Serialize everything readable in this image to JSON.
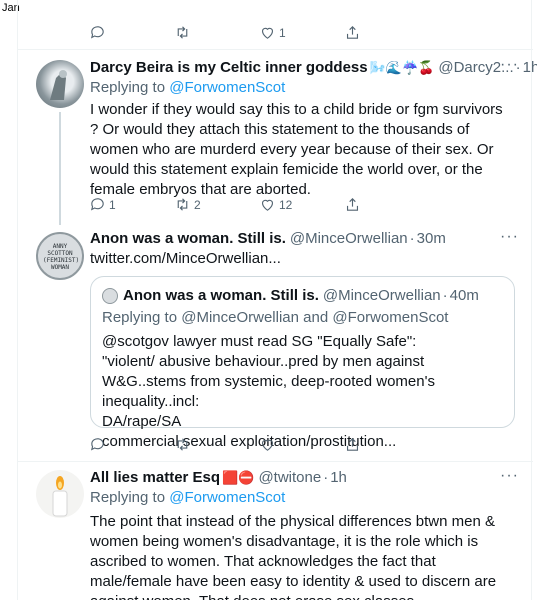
{
  "corner_label": "Jan",
  "top_actions": {
    "reply": "",
    "retweet": "",
    "like": "1",
    "share": ""
  },
  "tweet1": {
    "name": "Darcy Beira is my Celtic inner goddess",
    "name_emojis": "🌬️🌊☔️🍒",
    "handle": "@Darcy2...",
    "dot": "·",
    "time": "1h",
    "replying_prefix": "Replying to",
    "replying_to": "@ForwomenScot",
    "text": "I wonder if they would say this to a child bride or fgm survivors ? Or would they attach this statement to the thousands of women who are murderd every year because of their sex. Or would this statement explain femicide the world over, or the female embryos that are aborted.",
    "reply_count": "1",
    "retweet_count": "2",
    "like_count": "12"
  },
  "tweet2": {
    "name": "Anon was a woman. Still is.",
    "handle": "@MinceOrwellian",
    "dot": "·",
    "time": "30m",
    "link": "twitter.com/MinceOrwellian...",
    "avatar_text": "ANNY SCOTTON (FEMINIST) WOMAN",
    "quote": {
      "name": "Anon was a woman. Still is.",
      "handle": "@MinceOrwellian",
      "dot": "·",
      "time": "40m",
      "replying_prefix": "Replying to",
      "replying_to_1": "@MinceOrwellian",
      "replying_and": "and",
      "replying_to_2": "@ForwomenScot",
      "lines": [
        "@scotgov lawyer must read SG \"Equally Safe\":",
        "\"violent/ abusive behaviour..pred by men against W&G..stems from systemic, deep-rooted women's inequality..incl:",
        "DA/rape/SA",
        "commercial sexual exploitation/prostitution..."
      ]
    }
  },
  "tweet3": {
    "name": "All lies matter Esq",
    "name_emojis": "🟥⛔",
    "handle": "@twitone",
    "dot": "·",
    "time": "1h",
    "replying_prefix": "Replying to",
    "replying_to": "@ForwomenScot",
    "text": "The point that instead of the physical differences btwn men & women being women's disadvantage, it is the role which is ascribed to women. That acknowledges the fact that male/female have been easy to identity & used to discern are against women. That does not erase sex classes."
  },
  "colors": {
    "link": "#1d9bf0",
    "muted": "#536471",
    "text": "#0f1419",
    "border": "#cfd9de"
  },
  "icons": [
    "reply-icon",
    "retweet-icon",
    "like-icon",
    "share-icon",
    "more-icon"
  ]
}
